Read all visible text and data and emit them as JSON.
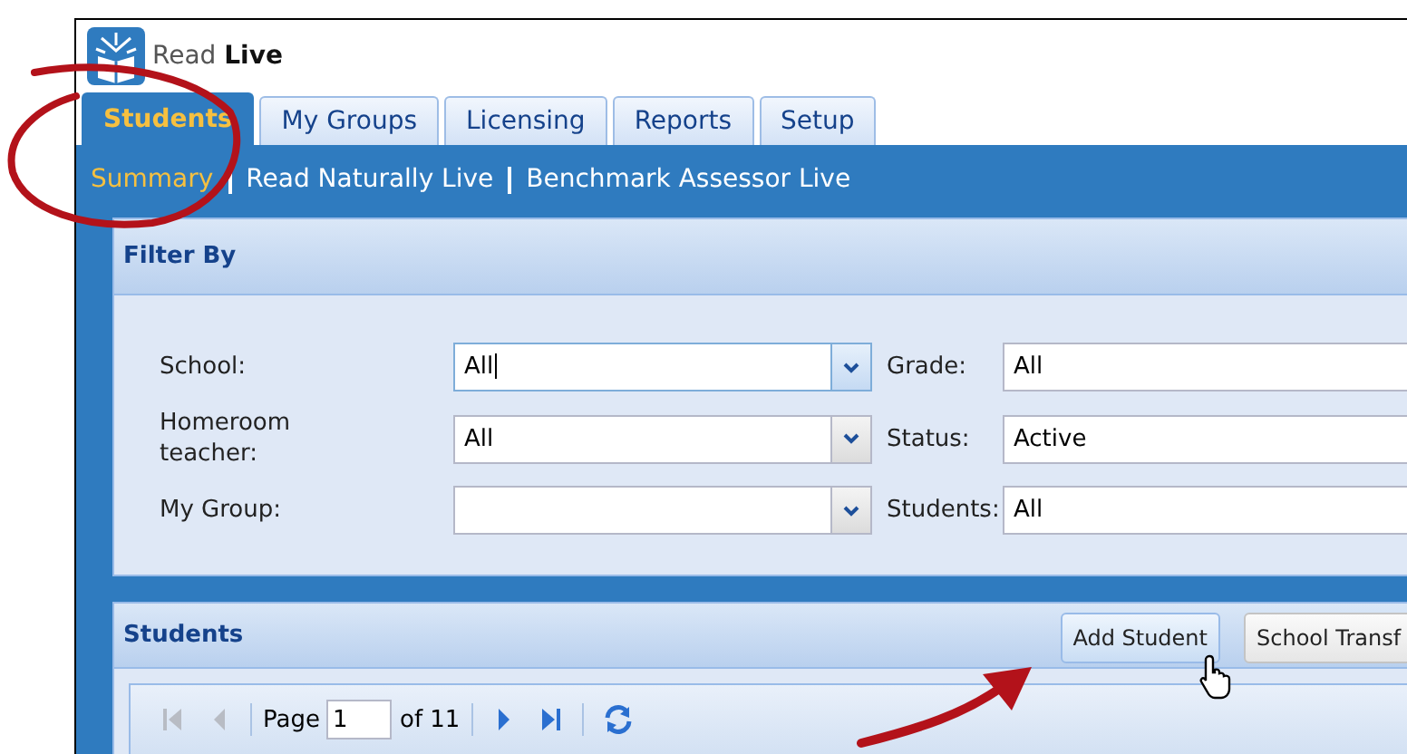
{
  "app": {
    "title": "Read **Live**"
  },
  "tabs": [
    {
      "label": "Students",
      "selected": true
    },
    {
      "label": "My Groups",
      "selected": false
    },
    {
      "label": "Licensing",
      "selected": false
    },
    {
      "label": "Reports",
      "selected": false
    },
    {
      "label": "Setup",
      "selected": false
    }
  ],
  "subnav": [
    {
      "label": "Summary",
      "selected": true
    },
    {
      "label": "Read Naturally Live",
      "selected": false
    },
    {
      "label": "Benchmark Assessor Live",
      "selected": false
    }
  ],
  "filter": {
    "title": "Filter By",
    "fields": [
      {
        "label": "School:",
        "value": "All",
        "focused": true
      },
      {
        "label": "Grade:",
        "value": "All",
        "focused": false
      },
      {
        "label": "Homeroom teacher:",
        "value": "All",
        "focused": false
      },
      {
        "label": "Status:",
        "value": "Active",
        "focused": false
      },
      {
        "label": "My Group:",
        "focused": false
      },
      {
        "label": "Students:",
        "value": "All",
        "focused": false
      }
    ]
  },
  "students": {
    "title": "Students",
    "buttons": [
      {
        "label": "Add Student",
        "hovered": true
      },
      {
        "label": "School Transf",
        "hovered": false
      }
    ],
    "pager": {
      "page_label": "Page",
      "page_value": "1",
      "of_label": "of 11"
    }
  }
}
